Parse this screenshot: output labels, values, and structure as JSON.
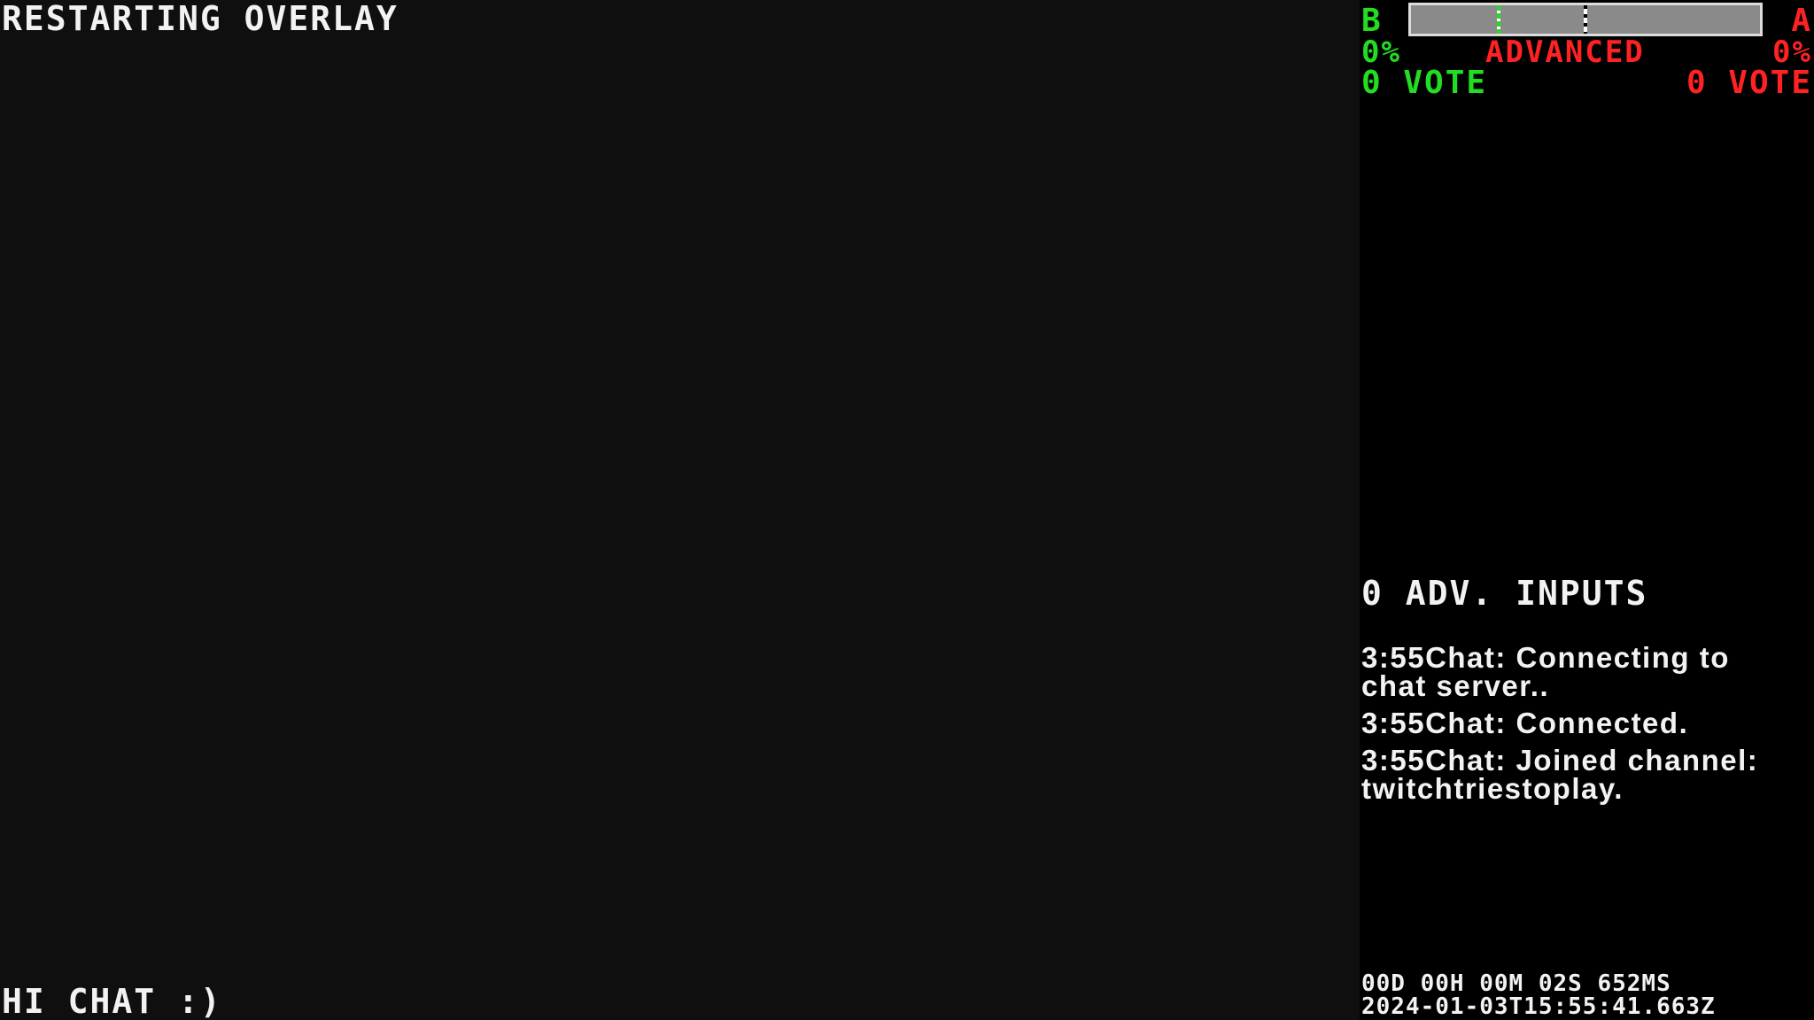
{
  "overlay": {
    "status": "RESTARTING OVERLAY",
    "footer_message": "HI CHAT :)"
  },
  "vote_meter": {
    "left_label": "B",
    "right_label": "A",
    "left_percent": "0%",
    "right_percent": "0%",
    "mode": "ADVANCED",
    "left_votes": "0 VOTE",
    "right_votes": "0 VOTE",
    "green_marker_fraction": 0.25,
    "white_marker_fraction": 0.5,
    "colors": {
      "left": "#22dd22",
      "right": "#ff2222",
      "track": "#8a8a8a",
      "border": "#dcdcdc"
    }
  },
  "advanced_inputs": "0 ADV. INPUTS",
  "chat": {
    "messages": [
      {
        "time": "3:55",
        "text": "Chat: Connecting to chat server.."
      },
      {
        "time": "3:55",
        "text": "Chat: Connected."
      },
      {
        "time": "3:55",
        "text": "Chat: Joined channel: twitchtriestoplay."
      }
    ]
  },
  "clock": {
    "uptime": "00D 00H 00M 02S 652MS",
    "timestamp": "2024-01-03T15:55:41.663Z"
  }
}
